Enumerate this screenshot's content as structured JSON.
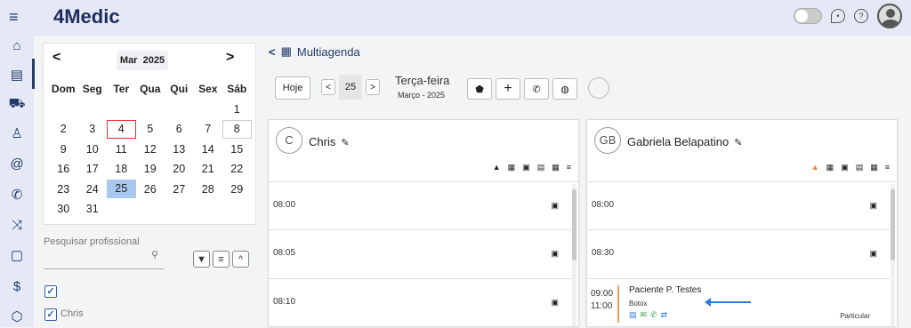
{
  "app": {
    "logo": "4Medic"
  },
  "topbar": {
    "menu_icon": "hamburger-icon",
    "toggle_state": "off",
    "icons": [
      "chat-icon",
      "help-icon",
      "user-avatar-icon"
    ]
  },
  "sidebar": {
    "icons": [
      "home-icon",
      "calendar-icon",
      "car-icon",
      "user-icon",
      "at-icon",
      "phone-icon",
      "shuffle-icon",
      "clipboard-icon",
      "dollar-icon",
      "cube-icon"
    ]
  },
  "calendar": {
    "prev": "<",
    "next": ">",
    "month": "Mar",
    "year": "2025",
    "weekdays": [
      "Dom",
      "Seg",
      "Ter",
      "Qua",
      "Qui",
      "Sex",
      "Sáb"
    ],
    "weeks": [
      [
        "",
        "",
        "",
        "",
        "",
        "",
        "1"
      ],
      [
        "2",
        "3",
        "4",
        "5",
        "6",
        "7",
        "8"
      ],
      [
        "9",
        "10",
        "11",
        "12",
        "13",
        "14",
        "15"
      ],
      [
        "16",
        "17",
        "18",
        "19",
        "20",
        "21",
        "22"
      ],
      [
        "23",
        "24",
        "25",
        "26",
        "27",
        "28",
        "29"
      ],
      [
        "30",
        "31",
        "",
        "",
        "",
        "",
        ""
      ]
    ],
    "today": "4",
    "selected": "25"
  },
  "search": {
    "placeholder": "Pesquisar profissional"
  },
  "filter": {
    "buttons": [
      "filter-icon",
      "list-icon",
      "chevron-up-icon"
    ]
  },
  "professionals": {
    "all_checked": true,
    "items": [
      {
        "name": "Chris",
        "checked": true
      }
    ]
  },
  "main": {
    "back": "<",
    "title": "Multiagenda",
    "today_btn": "Hoje",
    "prev_day": "<",
    "date_num": "25",
    "next_day": ">",
    "day_name": "Terça-feira",
    "month_year": "Março - 2025"
  },
  "columns": [
    {
      "initials": "C",
      "name": "Chris",
      "slots": [
        "08:00",
        "08:05",
        "08:10"
      ]
    },
    {
      "initials": "GB",
      "name": "Gabriela Belapatino",
      "slots": [
        "08:00",
        "08:30"
      ],
      "appointment": {
        "start": "09:00",
        "end": "11:00",
        "patient": "Paciente P. Testes",
        "procedure": "Botox",
        "payment": "Particular"
      }
    }
  ],
  "colors": {
    "accent": "#233a6b",
    "sidebar": "#e4e9f5",
    "selected": "#a9c8ef",
    "today_border": "#dd3333",
    "appt_bar": "#f0a050",
    "arrow": "#2c7be0"
  }
}
